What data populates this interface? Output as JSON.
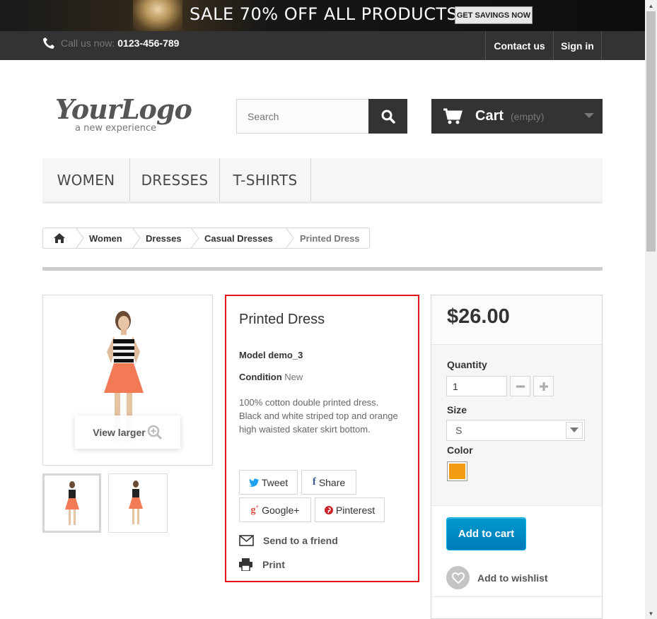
{
  "banner": {
    "text": "SALE 70% OFF ALL PRODUCTS",
    "button": "GET SAVINGS NOW"
  },
  "nav": {
    "call_label": "Call us now:",
    "phone": "0123-456-789",
    "contact": "Contact us",
    "signin": "Sign in"
  },
  "logo": {
    "name": "YourLogo",
    "tagline": "a new experience"
  },
  "search": {
    "placeholder": "Search"
  },
  "cart": {
    "label": "Cart",
    "status": "(empty)"
  },
  "menu": {
    "items": [
      "WOMEN",
      "DRESSES",
      "T-SHIRTS"
    ]
  },
  "breadcrumb": {
    "items": [
      "Women",
      "Dresses",
      "Casual Dresses",
      "Printed Dress"
    ]
  },
  "product": {
    "view_larger": "View larger",
    "title": "Printed Dress",
    "model_label": "Model",
    "model": "demo_3",
    "condition_label": "Condition",
    "condition": "New",
    "description": "100% cotton double printed dress. Black and white striped top and orange high waisted skater skirt bottom.",
    "share": {
      "tweet": "Tweet",
      "share": "Share",
      "google": "Google+",
      "pinterest": "Pinterest"
    },
    "send_friend": "Send to a friend",
    "print": "Print"
  },
  "buy": {
    "price": "$26.00",
    "quantity_label": "Quantity",
    "quantity": "1",
    "size_label": "Size",
    "size": "S",
    "color_label": "Color",
    "color": "#f39c11",
    "add_to_cart": "Add to cart",
    "wishlist": "Add to wishlist"
  },
  "colors": {
    "accent": "#007ab7",
    "highlight_border": "#e8141b",
    "dark": "#333333"
  }
}
